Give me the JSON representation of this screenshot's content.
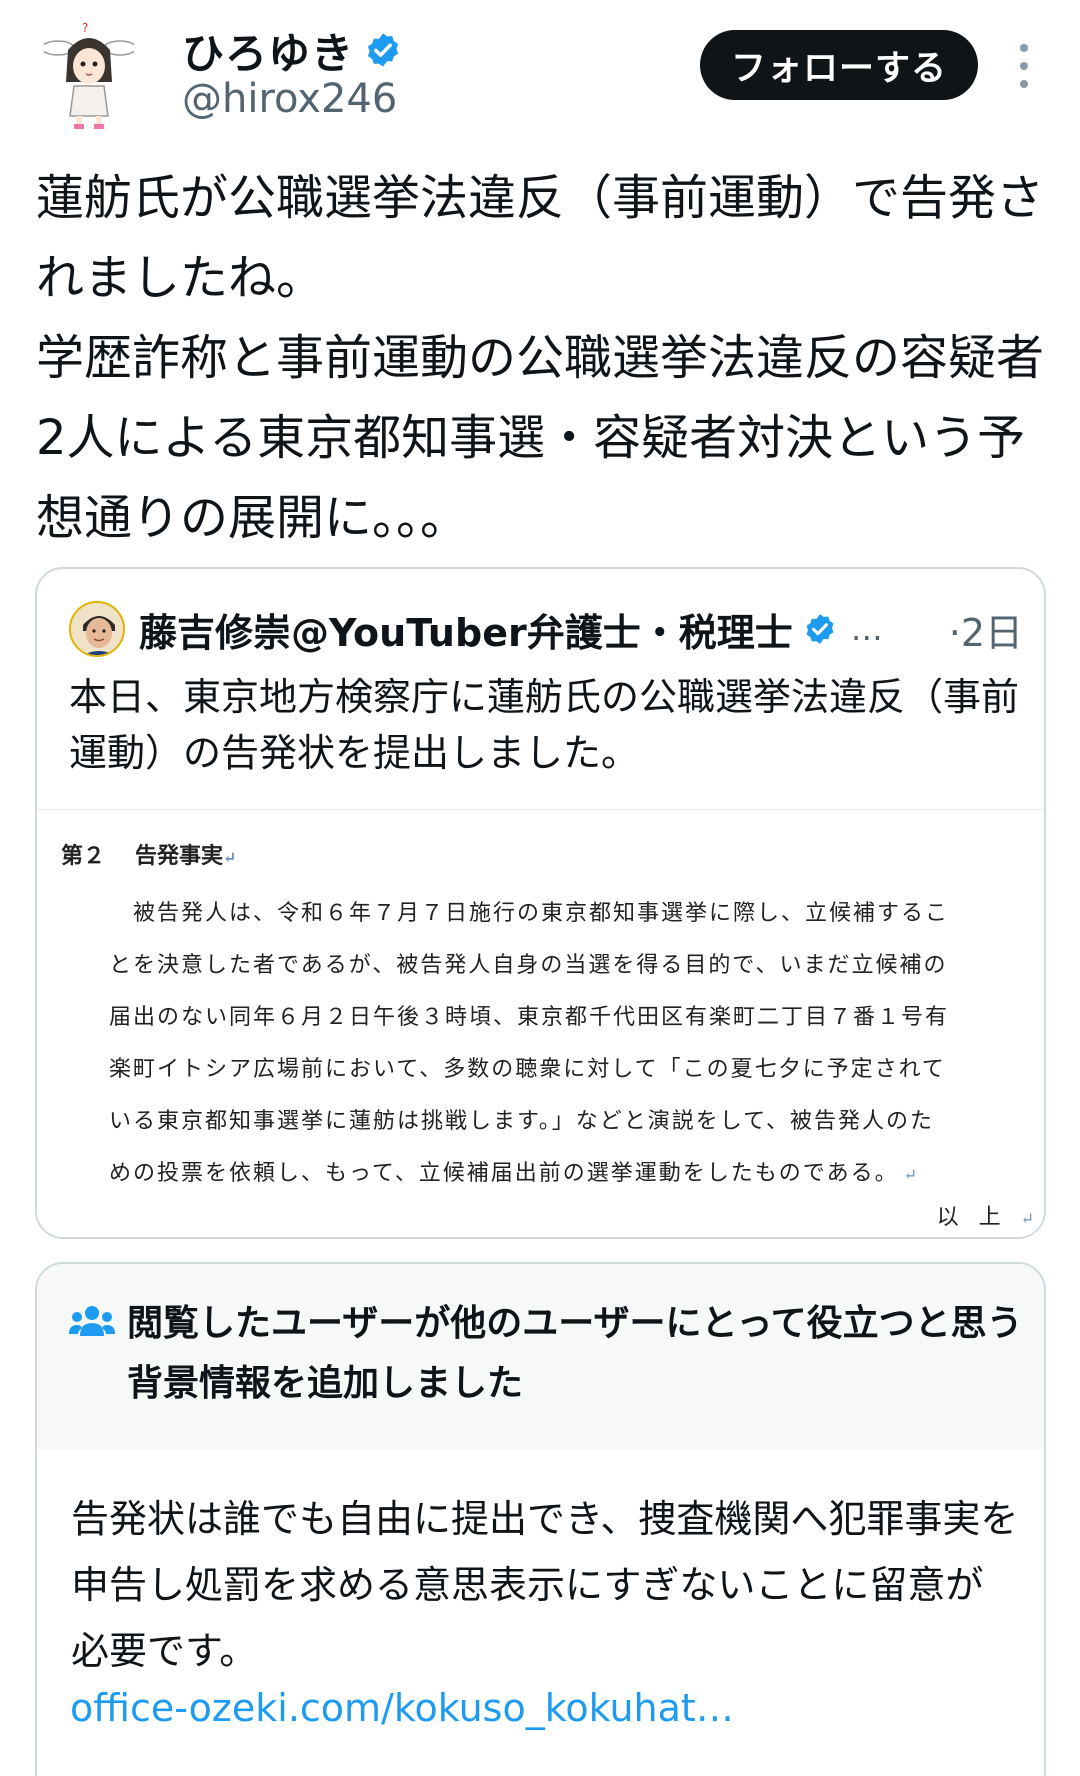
{
  "header": {
    "display_name": "ひろゆき",
    "handle": "@hirox246",
    "follow_label": "フォローする"
  },
  "tweet": {
    "text": "蓮舫氏が公職選挙法違反（事前運動）で告発されましたね。\n学歴詐称と事前運動の公職選挙法違反の容疑者2人による東京都知事選・容疑者対決という予想通りの展開に。。。"
  },
  "quote": {
    "author_name": "藤吉修崇@YouTuber弁護士・税理士",
    "ellipsis": "…",
    "time": "·2日",
    "text": "本日、東京地方検察庁に蓮舫氏の公職選挙法違反（事前運動）の告発状を提出しました。",
    "document": {
      "heading_number": "第２",
      "heading_title": "告発事実",
      "lines": [
        "被告発人は、令和６年７月７日施行の東京都知事選挙に際し、立候補するこ",
        "とを決意した者であるが、被告発人自身の当選を得る目的で、いまだ立候補の",
        "届出のない同年６月２日午後３時頃、東京都千代田区有楽町二丁目７番１号有",
        "楽町イトシア広場前において、多数の聴衆に対して「この夏七夕に予定されて",
        "いる東京都知事選挙に蓮舫は挑戦します。」などと演説をして、被告発人のた",
        "めの投票を依頼し、もって、立候補届出前の選挙運動をしたものである。"
      ],
      "end_mark": "以上"
    }
  },
  "note": {
    "title": "閲覧したユーザーが他のユーザーにとって役立つと思う背景情報を追加しました",
    "body": "告発状は誰でも自由に提出でき、捜査機関へ犯罪事実を申告し処罰を求める意思表示にすぎないことに留意が必要です。",
    "link": "office-ozeki.com/kokuso_kokuhat…"
  },
  "colors": {
    "verified": "#1d9bf0",
    "link": "#1d9bf0",
    "follow_bg": "#0f1419",
    "secondary_text": "#536471",
    "border": "#cfd9de"
  },
  "icons": [
    "avatar",
    "verified-badge-icon",
    "more-options-icon",
    "community-notes-icon"
  ]
}
